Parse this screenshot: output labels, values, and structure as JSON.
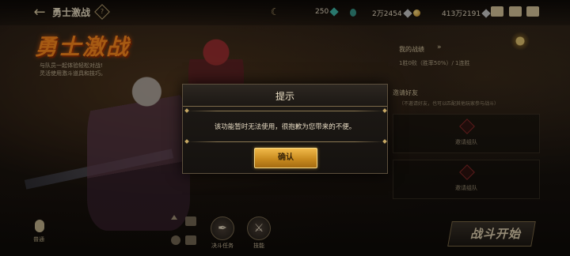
{
  "header": {
    "title": "勇士激战",
    "currencies": [
      {
        "value": "250",
        "icon": "green-gem-icon",
        "color": "#3fb8a8"
      },
      {
        "value": "2万2454",
        "icon": "silver-gem-icon",
        "color": "#c8c8c8"
      },
      {
        "value": "413万2191",
        "icon": "gold-coin-icon",
        "color": "#e0a530"
      }
    ]
  },
  "mode": {
    "logo_text": "勇士激战",
    "description_line1": "与队员一起体验轻松对战!",
    "description_line2": "灵活使用激斗道具和技巧。"
  },
  "panel": {
    "stats_title": "我的战绩",
    "stats_value": "1胜0败（胜率50%）/ 1连胜",
    "invite_title": "邀请好友",
    "invite_desc": "（不邀请好友，也可以匹配其他玩家参与战斗）",
    "slot_label": "邀请组队"
  },
  "bottom": {
    "voice_label": "普通",
    "quest_label": "决斗任务",
    "skill_label": "技能",
    "start_label": "战斗开始"
  },
  "dialog": {
    "title": "提示",
    "message": "该功能暂时无法使用，很抱歉为您带来的不便。",
    "confirm_label": "确认"
  },
  "colors": {
    "accent_gold": "#d9a338",
    "logo_orange": "#ff8a1e"
  }
}
